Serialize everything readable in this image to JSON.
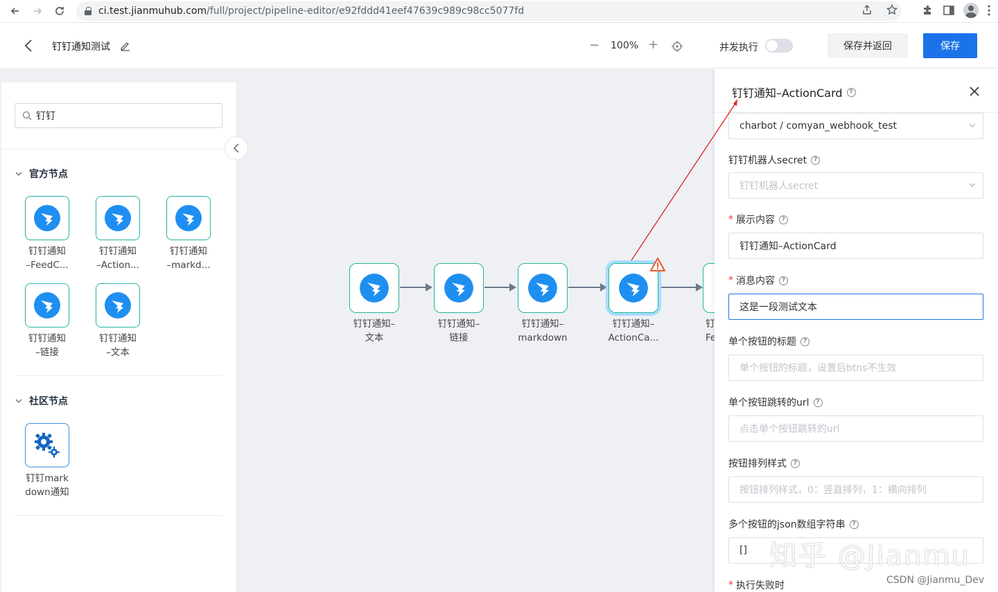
{
  "browser": {
    "url_host": "ci.test.jianmuhub.com",
    "url_path": "/full/project/pipeline-editor/e92fddd41eef47639c989c98cc5077fd"
  },
  "header": {
    "title": "钉钉通知测试",
    "zoom_out": "−",
    "zoom_level": "100%",
    "zoom_in": "+",
    "concurrent_label": "并发执行",
    "concurrent_enabled": false,
    "save_back_label": "保存并返回",
    "save_label": "保存"
  },
  "left_panel": {
    "search_value": "钉钉",
    "official_section": "官方节点",
    "official_nodes": [
      {
        "label": "钉钉通知\n–FeedC..."
      },
      {
        "label": "钉钉通知\n–Action..."
      },
      {
        "label": "钉钉通知\n–markd..."
      },
      {
        "label": "钉钉通知\n–链接"
      },
      {
        "label": "钉钉通知\n–文本"
      }
    ],
    "community_section": "社区节点",
    "community_nodes": [
      {
        "label": "钉钉mark\ndown通知"
      }
    ]
  },
  "pipeline": {
    "nodes": [
      {
        "label_1": "钉钉通知–",
        "label_2": "文本"
      },
      {
        "label_1": "钉钉通知–",
        "label_2": "链接"
      },
      {
        "label_1": "钉钉通知–",
        "label_2": "markdown"
      },
      {
        "label_1": "钉钉通知–",
        "label_2": "ActionCa..."
      },
      {
        "label_1": "钉",
        "label_2": "Fe"
      }
    ]
  },
  "right_panel": {
    "title": "钉钉通知–ActionCard",
    "webhook_value": "charbot / comyan_webhook_test",
    "secret_label": "钉钉机器人secret",
    "secret_placeholder": "钉钉机器人secret",
    "show_label": "展示内容",
    "show_value": "钉钉通知–ActionCard",
    "msg_label": "消息内容",
    "msg_value": "这是一段测试文本",
    "btn_title_label": "单个按钮的标题",
    "btn_title_placeholder": "单个按钮的标题，设置后btns不生效",
    "btn_url_label": "单个按钮跳转的url",
    "btn_url_placeholder": "点击单个按钮跳转的url",
    "btn_orient_label": "按钮排列样式",
    "btn_orient_placeholder": "按钮排列样式，0：竖直排列，1：横向排列",
    "btns_label": "多个按钮的json数组字符串",
    "btns_value": "[]",
    "fail_label": "执行失败时",
    "required_mark": "*"
  },
  "watermarks": {
    "zhihu": "知乎 @Jianmu",
    "csdn": "CSDN @Jianmu_Dev"
  },
  "colors": {
    "primary": "#1a73e8",
    "node_border": "#22b59b",
    "dingtalk_blue": "#1e8ff0",
    "annotation_red": "#e02020"
  }
}
